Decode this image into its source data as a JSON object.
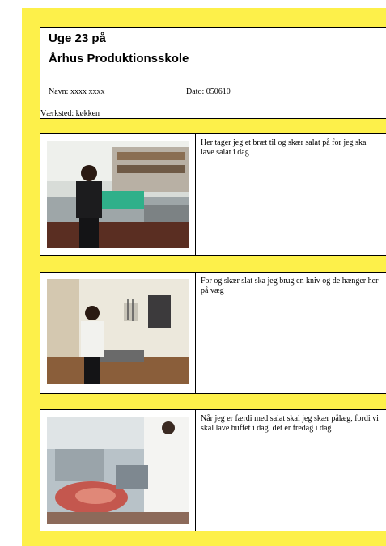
{
  "header": {
    "title_line1": "Uge  23  på",
    "title_line2": "Århus Produktionsskole",
    "name": "Navn:  xxxx  xxxx",
    "date": "Dato: 050610",
    "workshop": "Værksted:  køkken"
  },
  "entries": [
    {
      "photo_label": "kitchen-photo-cutting-board",
      "text": "Her tager jeg et bræt til og skær salat på for jeg ska lave salat i dag"
    },
    {
      "photo_label": "kitchen-photo-knives",
      "text": "For og skær slat ska jeg brug en kniv og de hænger her på væg"
    },
    {
      "photo_label": "kitchen-photo-meat",
      "text": "Når jeg er færdi med salat skal jeg skær pålæg, fordi vi skal lave buffet i dag. det er fredag i dag"
    }
  ],
  "colors": {
    "page_background": "#fdf04a"
  }
}
